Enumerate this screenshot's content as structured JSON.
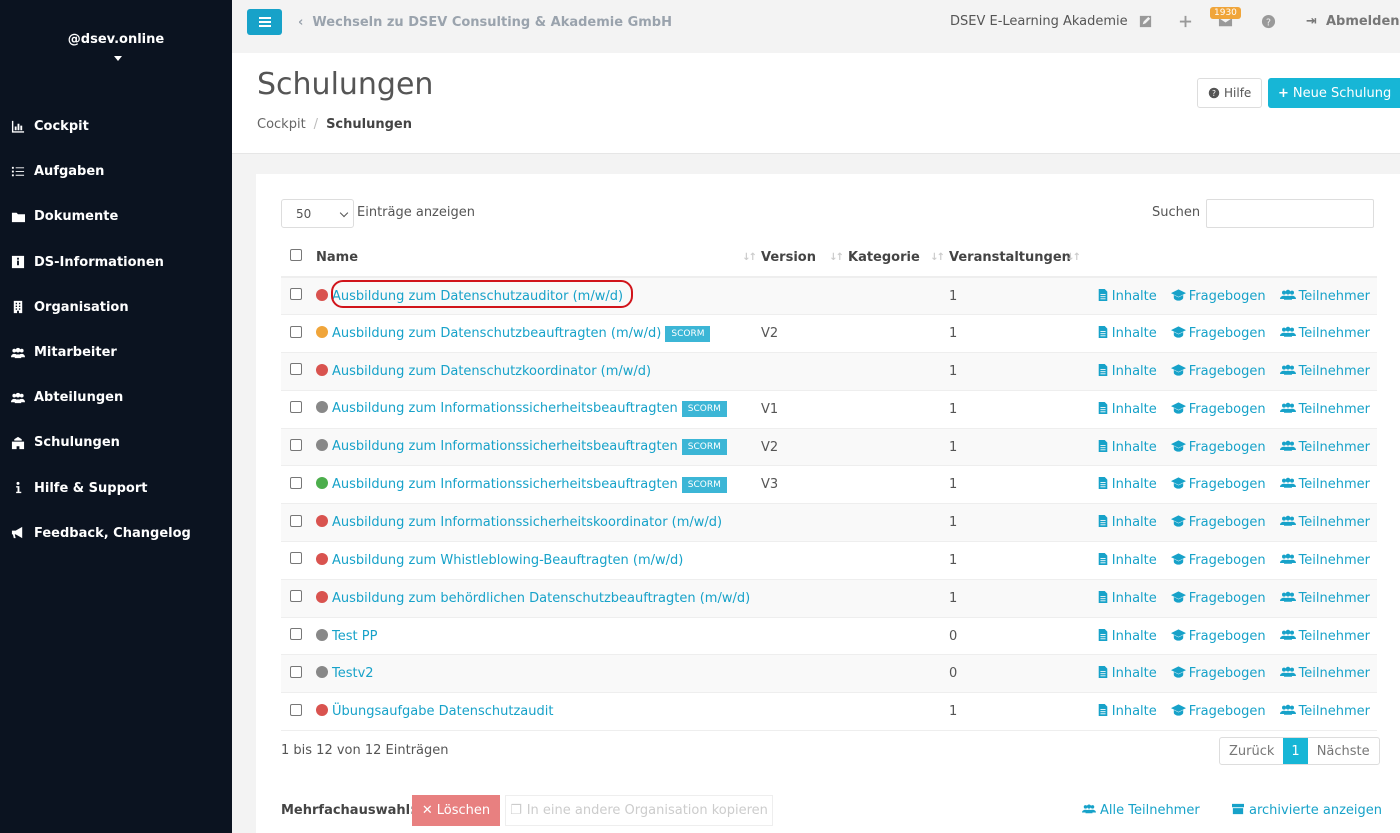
{
  "sidebar": {
    "user": "@dsev.online",
    "items": [
      {
        "label": "Cockpit",
        "icon": "chart-icon"
      },
      {
        "label": "Aufgaben",
        "icon": "tasks-icon"
      },
      {
        "label": "Dokumente",
        "icon": "folder-icon"
      },
      {
        "label": "DS-Informationen",
        "icon": "info-box-icon"
      },
      {
        "label": "Organisation",
        "icon": "building-icon"
      },
      {
        "label": "Mitarbeiter",
        "icon": "users-icon"
      },
      {
        "label": "Abteilungen",
        "icon": "users-icon"
      },
      {
        "label": "Schulungen",
        "icon": "school-icon"
      },
      {
        "label": "Hilfe & Support",
        "icon": "info-icon"
      },
      {
        "label": "Feedback, Changelog",
        "icon": "megaphone-icon"
      }
    ]
  },
  "topbar": {
    "switch_link": "Wechseln zu DSEV Consulting & Akademie GmbH",
    "org_name": "DSEV E-Learning Akademie",
    "badge": "1930",
    "logout": "Abmelden"
  },
  "header": {
    "title": "Schulungen",
    "breadcrumb_home": "Cockpit",
    "breadcrumb_current": "Schulungen",
    "help_label": "Hilfe",
    "new_label": "Neue Schulung"
  },
  "table": {
    "length_value": "50",
    "length_label": "Einträge anzeigen",
    "search_label": "Suchen",
    "columns": {
      "name": "Name",
      "version": "Version",
      "kategorie": "Kategorie",
      "veranstaltungen": "Veranstaltungen"
    },
    "actions": {
      "inhalte": "Inhalte",
      "fragebogen": "Fragebogen",
      "teilnehmer": "Teilnehmer"
    },
    "scorm_label": "SCORM",
    "rows": [
      {
        "name": "Ausbildung zum Datenschutzauditor (m/w/d)",
        "status": "#d9534f",
        "scorm": false,
        "version": "",
        "kategorie": "",
        "veranstaltungen": "1"
      },
      {
        "name": "Ausbildung zum Datenschutzbeauftragten (m/w/d)",
        "status": "#f0a53a",
        "scorm": true,
        "version": "V2",
        "kategorie": "",
        "veranstaltungen": "1"
      },
      {
        "name": "Ausbildung zum Datenschutzkoordinator (m/w/d)",
        "status": "#d9534f",
        "scorm": false,
        "version": "",
        "kategorie": "",
        "veranstaltungen": "1"
      },
      {
        "name": "Ausbildung zum Informationssicherheitsbeauftragten",
        "status": "#888888",
        "scorm": true,
        "version": "V1",
        "kategorie": "",
        "veranstaltungen": "1"
      },
      {
        "name": "Ausbildung zum Informationssicherheitsbeauftragten",
        "status": "#888888",
        "scorm": true,
        "version": "V2",
        "kategorie": "",
        "veranstaltungen": "1"
      },
      {
        "name": "Ausbildung zum Informationssicherheitsbeauftragten",
        "status": "#4cae4c",
        "scorm": true,
        "version": "V3",
        "kategorie": "",
        "veranstaltungen": "1"
      },
      {
        "name": "Ausbildung zum Informationssicherheitskoordinator (m/w/d)",
        "status": "#d9534f",
        "scorm": false,
        "version": "",
        "kategorie": "",
        "veranstaltungen": "1"
      },
      {
        "name": "Ausbildung zum Whistleblowing-Beauftragten (m/w/d)",
        "status": "#d9534f",
        "scorm": false,
        "version": "",
        "kategorie": "",
        "veranstaltungen": "1"
      },
      {
        "name": "Ausbildung zum behördlichen Datenschutzbeauftragten (m/w/d)",
        "status": "#d9534f",
        "scorm": false,
        "version": "",
        "kategorie": "",
        "veranstaltungen": "1"
      },
      {
        "name": "Test PP",
        "status": "#888888",
        "scorm": false,
        "version": "",
        "kategorie": "",
        "veranstaltungen": "0"
      },
      {
        "name": "Testv2",
        "status": "#888888",
        "scorm": false,
        "version": "",
        "kategorie": "",
        "veranstaltungen": "0"
      },
      {
        "name": "Übungsaufgabe Datenschutzaudit",
        "status": "#d9534f",
        "scorm": false,
        "version": "",
        "kategorie": "",
        "veranstaltungen": "1"
      }
    ],
    "info": "1 bis 12 von 12 Einträgen",
    "pager": {
      "prev": "Zurück",
      "page": "1",
      "next": "Nächste"
    }
  },
  "footer": {
    "multi_label": "Mehrfachauswahl:",
    "delete_label": "Löschen",
    "copy_label": "In eine andere Organisation kopieren",
    "all_participants": "Alle Teilnehmer",
    "archived": "archivierte anzeigen"
  }
}
